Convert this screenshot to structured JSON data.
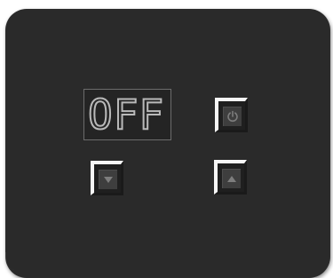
{
  "display": {
    "text": "OFF"
  },
  "buttons": {
    "power": {
      "icon": "power-icon"
    },
    "down": {
      "icon": "arrow-down-icon"
    },
    "up": {
      "icon": "arrow-up-icon"
    }
  },
  "colors": {
    "panel": "#2a2a2a",
    "button_highlight": "#f7f7f7",
    "display_segment": "#b9b9b9",
    "icon": "#7d7d7d"
  }
}
